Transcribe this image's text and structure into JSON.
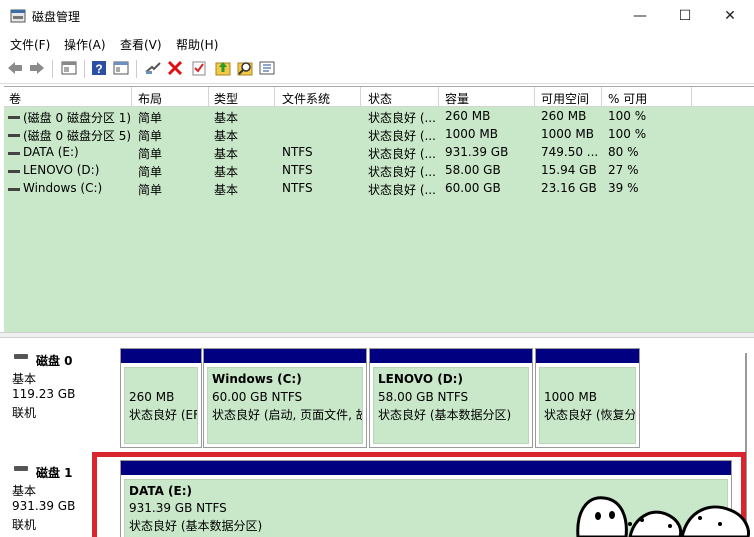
{
  "window": {
    "title": "磁盘管理",
    "minimize_glyph": "—",
    "maximize_glyph": "☐",
    "close_glyph": "✕"
  },
  "menu": [
    "文件(F)",
    "操作(A)",
    "查看(V)",
    "帮助(H)"
  ],
  "toolbar_icons": [
    "back-icon",
    "forward-icon",
    "console-icon",
    "help-icon",
    "properties-icon",
    "connect-icon",
    "delete-icon",
    "check-icon",
    "up-icon",
    "search-icon",
    "details-icon"
  ],
  "list": {
    "columns": [
      "卷",
      "布局",
      "类型",
      "文件系统",
      "状态",
      "容量",
      "可用空间",
      "% 可用"
    ],
    "rows": [
      {
        "volume": "(磁盘 0 磁盘分区 1)",
        "layout": "简单",
        "type": "基本",
        "fs": "",
        "status": "状态良好 (...",
        "capacity": "260 MB",
        "free": "260 MB",
        "pct": "100 %"
      },
      {
        "volume": "(磁盘 0 磁盘分区 5)",
        "layout": "简单",
        "type": "基本",
        "fs": "",
        "status": "状态良好 (...",
        "capacity": "1000 MB",
        "free": "1000 MB",
        "pct": "100 %"
      },
      {
        "volume": "DATA (E:)",
        "layout": "简单",
        "type": "基本",
        "fs": "NTFS",
        "status": "状态良好 (...",
        "capacity": "931.39 GB",
        "free": "749.50 ...",
        "pct": "80 %"
      },
      {
        "volume": "LENOVO (D:)",
        "layout": "简单",
        "type": "基本",
        "fs": "NTFS",
        "status": "状态良好 (...",
        "capacity": "58.00 GB",
        "free": "15.94 GB",
        "pct": "27 %"
      },
      {
        "volume": "Windows (C:)",
        "layout": "简单",
        "type": "基本",
        "fs": "NTFS",
        "status": "状态良好 (...",
        "capacity": "60.00 GB",
        "free": "23.16 GB",
        "pct": "39 %"
      }
    ]
  },
  "disks": [
    {
      "name": "磁盘 0",
      "kind": "基本",
      "size": "119.23 GB",
      "state": "联机",
      "partitions": [
        {
          "title": "",
          "size": "260 MB",
          "status": "状态良好 (EF"
        },
        {
          "title": "Windows  (C:)",
          "size": "60.00 GB NTFS",
          "status": "状态良好 (启动, 页面文件, 故"
        },
        {
          "title": "LENOVO  (D:)",
          "size": "58.00 GB NTFS",
          "status": "状态良好 (基本数据分区)"
        },
        {
          "title": "",
          "size": "1000 MB",
          "status": "状态良好 (恢复分"
        }
      ]
    },
    {
      "name": "磁盘 1",
      "kind": "基本",
      "size": "931.39 GB",
      "state": "联机",
      "partitions": [
        {
          "title": "DATA  (E:)",
          "size": "931.39 GB NTFS",
          "status": "状态良好 (基本数据分区)"
        }
      ]
    }
  ],
  "colors": {
    "partition_bar": "#000080",
    "partition_fill": "#c9e7c9",
    "highlight": "#d9262e"
  }
}
